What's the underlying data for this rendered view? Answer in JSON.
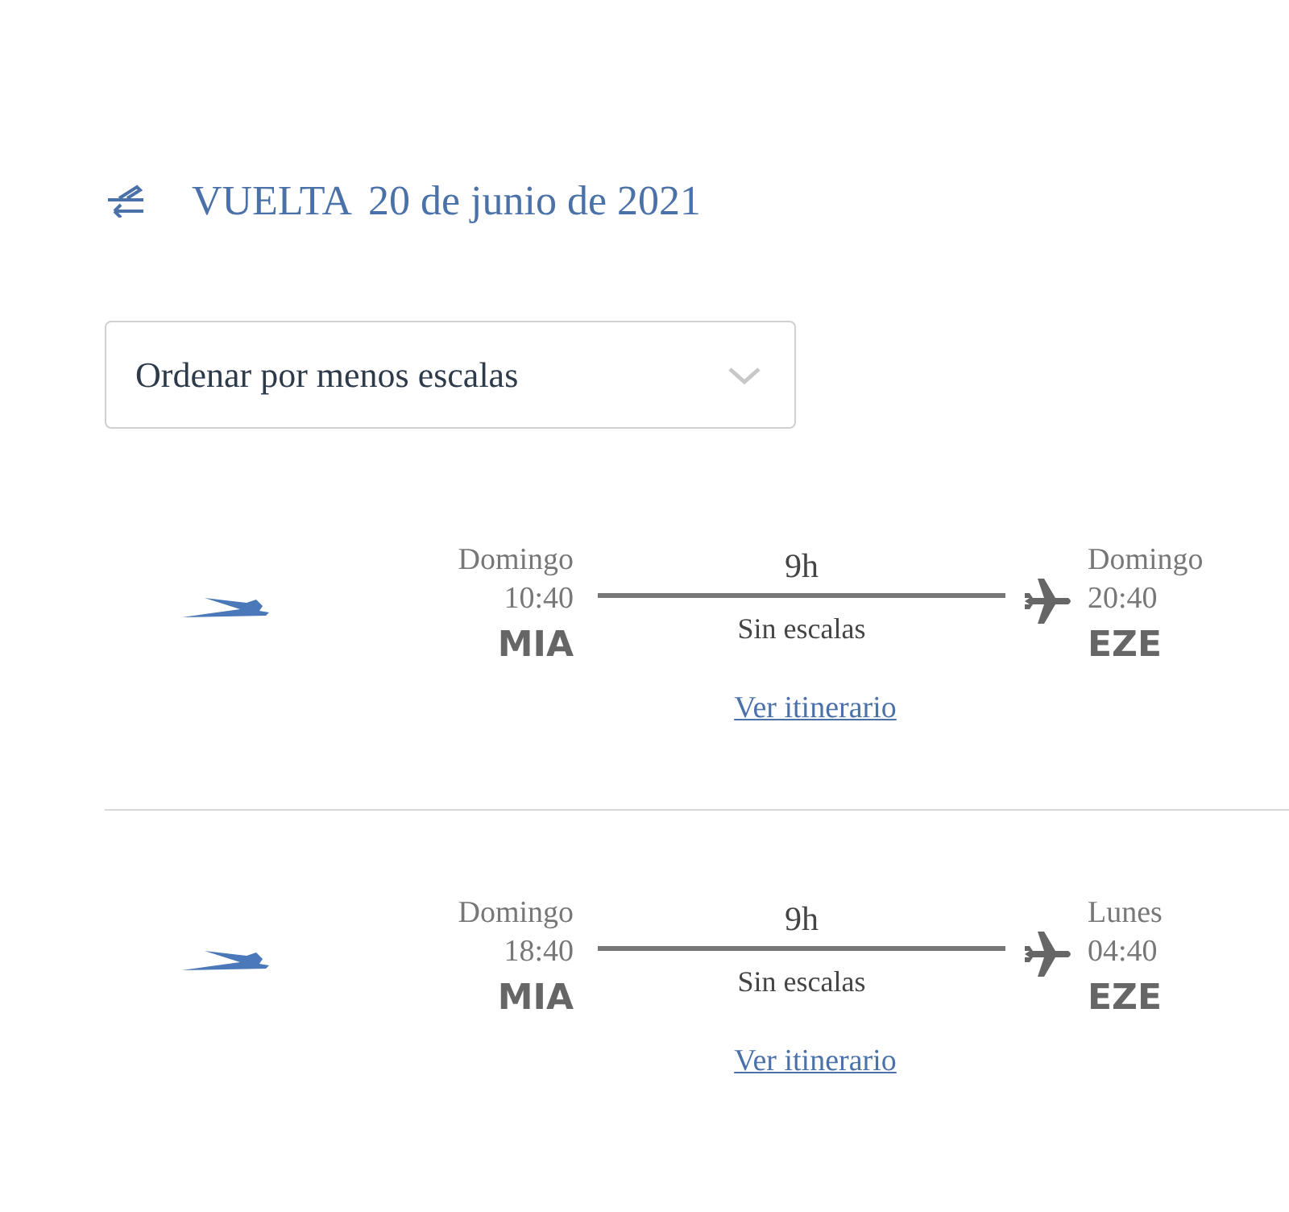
{
  "header": {
    "label": "VUELTA",
    "date": "20 de junio de 2021"
  },
  "sort_select": {
    "value": "Ordenar por menos escalas"
  },
  "flights": [
    {
      "departure": {
        "day": "Domingo",
        "time": "10:40",
        "code": "MIA"
      },
      "duration": "9h",
      "stops": "Sin escalas",
      "arrival": {
        "day": "Domingo",
        "time": "20:40",
        "code": "EZE"
      },
      "link": "Ver itinerario"
    },
    {
      "departure": {
        "day": "Domingo",
        "time": "18:40",
        "code": "MIA"
      },
      "duration": "9h",
      "stops": "Sin escalas",
      "arrival": {
        "day": "Lunes",
        "time": "04:40",
        "code": "EZE"
      },
      "link": "Ver itinerario"
    }
  ]
}
